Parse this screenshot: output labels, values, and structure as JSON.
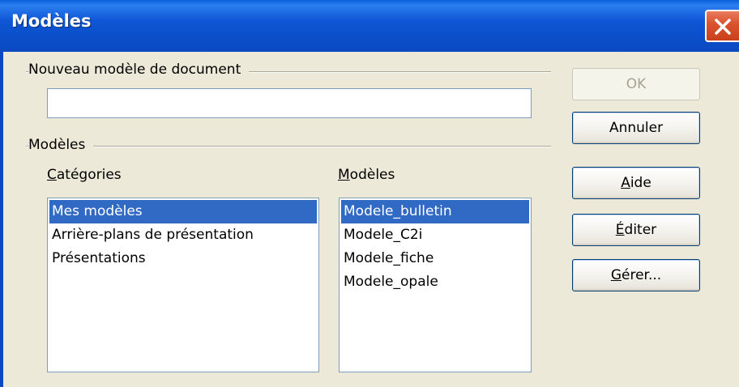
{
  "window": {
    "title": "Modèles"
  },
  "new_template": {
    "group_label": "Nouveau modèle de document",
    "value": ""
  },
  "templates_group": {
    "label": "Modèles"
  },
  "categories": {
    "label_first": "C",
    "label_rest": "atégories",
    "items": [
      "Mes modèles",
      "Arrière-plans de présentation",
      "Présentations"
    ],
    "selected_index": 0
  },
  "templates": {
    "label_first": "M",
    "label_rest": "odèles",
    "items": [
      "Modele_bulletin",
      "Modele_C2i",
      "Modele_fiche",
      "Modele_opale"
    ],
    "selected_index": 0
  },
  "buttons": {
    "ok": "OK",
    "cancel": "Annuler",
    "help_first": "A",
    "help_rest": "ide",
    "edit_first": "É",
    "edit_rest": "diter",
    "manage_first": "G",
    "manage_rest": "érer..."
  },
  "colors": {
    "title_bar": "#0b49c0",
    "selection": "#316ac5",
    "dialog_bg": "#ece9d8",
    "close_button": "#d9512d"
  },
  "icons": {
    "close": "close-x-icon"
  }
}
